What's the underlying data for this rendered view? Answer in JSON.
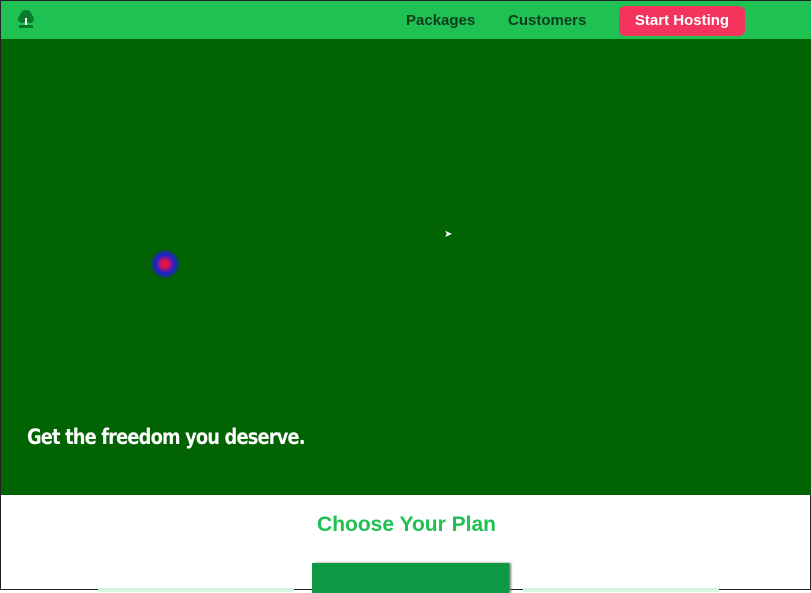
{
  "nav": {
    "logo": "tree-logo",
    "links": [
      "Packages",
      "Customers"
    ],
    "cta": "Start Hosting"
  },
  "hero": {
    "tagline": "Get the freedom you deserve."
  },
  "plans": {
    "title": "Choose Your Plan"
  },
  "colors": {
    "nav": "#1fc153",
    "hero": "#026302",
    "cta": "#f5345d"
  }
}
